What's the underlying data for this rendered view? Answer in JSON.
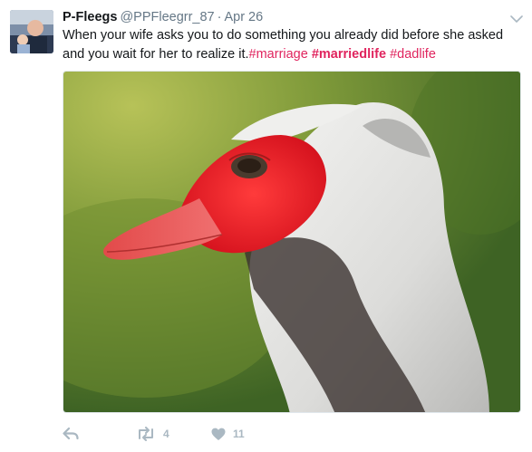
{
  "tweet": {
    "author_name": "P-Fleegs",
    "handle": "@PPFleegrr_87",
    "separator": "·",
    "date": "Apr 26",
    "text_plain": "When your wife asks you to do something you already did before she asked and you wait for her to realize it.",
    "hashtags": [
      "#marriage",
      "#marriedlife",
      "#dadlife"
    ],
    "media_alt": "Close-up of a white Muscovy duck with a red face",
    "actions": {
      "reply_icon": "reply-icon",
      "retweet_icon": "retweet-icon",
      "retweet_count": "4",
      "like_icon": "heart-icon",
      "like_count": "11"
    }
  },
  "colors": {
    "hashtag": "#e0245e",
    "muted_text": "#657786",
    "action_gray": "#aab8c2"
  }
}
